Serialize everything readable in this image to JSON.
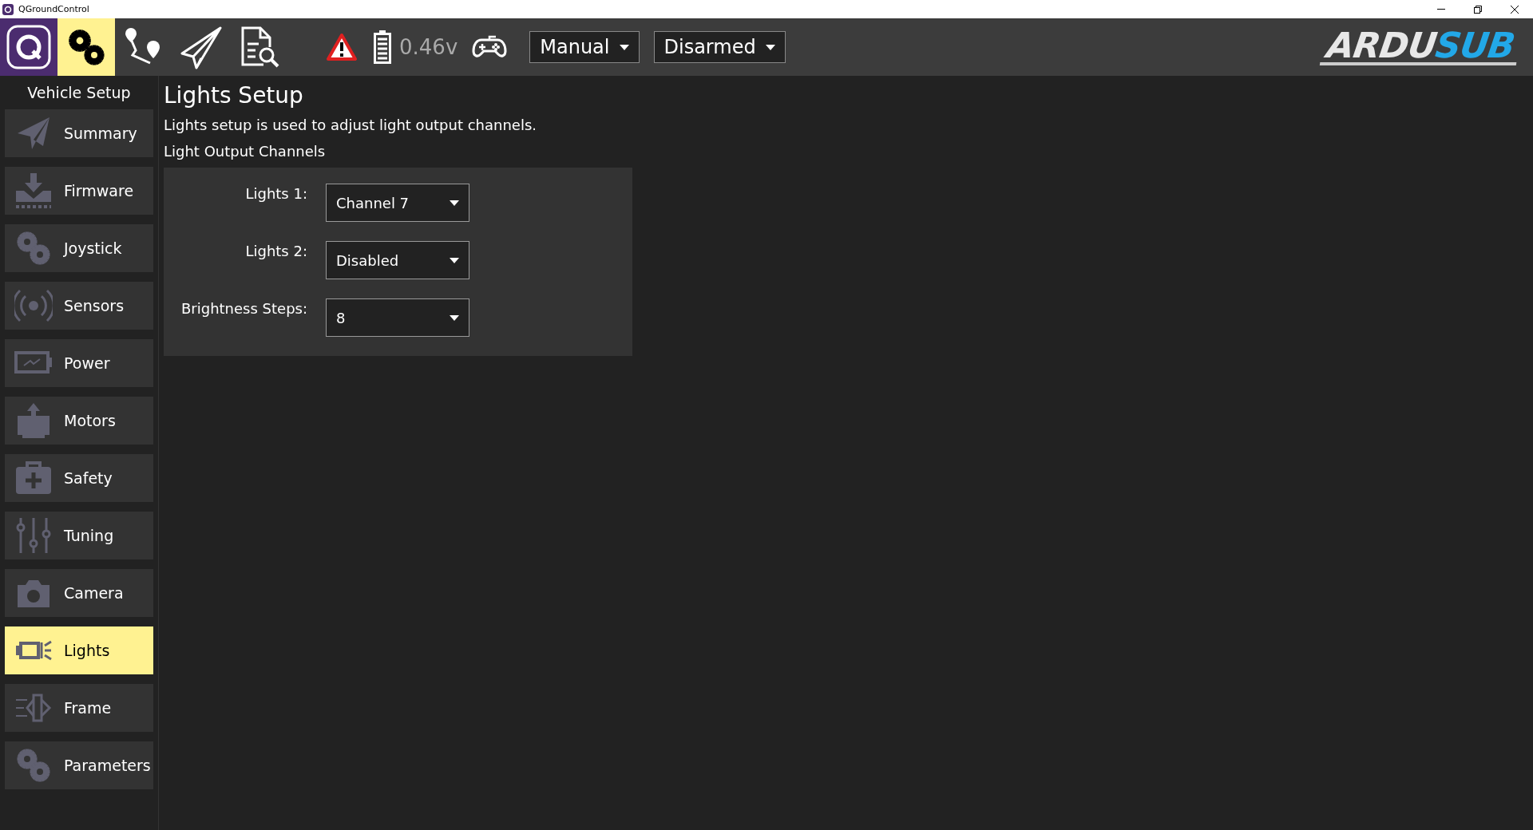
{
  "window": {
    "title": "QGroundControl"
  },
  "toolbar": {
    "tools": [
      {
        "kind": "app",
        "selected": false
      },
      {
        "kind": "setup",
        "selected": true
      },
      {
        "kind": "plan",
        "selected": false
      },
      {
        "kind": "fly",
        "selected": false
      },
      {
        "kind": "analyze",
        "selected": false
      }
    ],
    "battery_reading": "0.46v",
    "flight_mode": "Manual",
    "arm_state": "Disarmed",
    "logo": {
      "part_1": "ARDU",
      "part_2": "SUB"
    }
  },
  "sidebar": {
    "title": "Vehicle Setup",
    "items": [
      {
        "kind": "summary",
        "label": "Summary",
        "selected": false
      },
      {
        "kind": "firmware",
        "label": "Firmware",
        "selected": false
      },
      {
        "kind": "gears",
        "label": "Joystick",
        "selected": false
      },
      {
        "kind": "sensors",
        "label": "Sensors",
        "selected": false
      },
      {
        "kind": "power",
        "label": "Power",
        "selected": false
      },
      {
        "kind": "motors",
        "label": "Motors",
        "selected": false
      },
      {
        "kind": "safety",
        "label": "Safety",
        "selected": false
      },
      {
        "kind": "tuning",
        "label": "Tuning",
        "selected": false
      },
      {
        "kind": "camera",
        "label": "Camera",
        "selected": false
      },
      {
        "kind": "lights",
        "label": "Lights",
        "selected": true
      },
      {
        "kind": "frame",
        "label": "Frame",
        "selected": false
      },
      {
        "kind": "gears",
        "label": "Parameters",
        "selected": false
      }
    ]
  },
  "page": {
    "title": "Lights Setup",
    "description": "Lights setup is used to adjust light output channels.",
    "section": "Light Output Channels",
    "settings": [
      {
        "label": "Lights 1:",
        "value": "Channel 7"
      },
      {
        "label": "Lights 2:",
        "value": "Disabled"
      },
      {
        "label": "Brightness Steps:",
        "value": "8"
      }
    ]
  }
}
